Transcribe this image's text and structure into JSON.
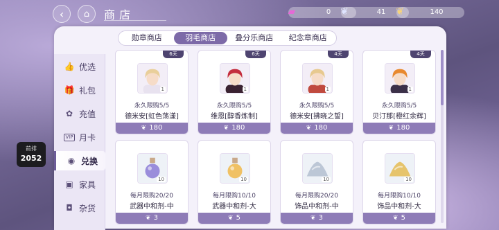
{
  "header": {
    "title": "商店"
  },
  "currencies": [
    {
      "icon": "ticket-icon",
      "value": "0"
    },
    {
      "icon": "feather-icon",
      "value": "41"
    },
    {
      "icon": "gold-feather-icon",
      "value": "140"
    }
  ],
  "sidebar": {
    "items": [
      {
        "label": "优选",
        "icon": "thumbs-up-icon"
      },
      {
        "label": "礼包",
        "icon": "gift-icon"
      },
      {
        "label": "充值",
        "icon": "flower-icon"
      },
      {
        "label": "月卡",
        "icon": "vip-card-icon"
      },
      {
        "label": "兑换",
        "icon": "exchange-icon",
        "active": true
      },
      {
        "label": "家具",
        "icon": "sofa-icon"
      },
      {
        "label": "杂货",
        "icon": "bag-icon"
      }
    ]
  },
  "rank": {
    "line1": "前排",
    "line2": "2052"
  },
  "tabs": [
    {
      "label": "勋章商店"
    },
    {
      "label": "羽毛商店",
      "active": true
    },
    {
      "label": "叠分乐商店"
    },
    {
      "label": "纪念章商店"
    }
  ],
  "items": [
    {
      "timer": "6天",
      "qty": "1",
      "limit": "永久限购5/5",
      "name": "德米安[虹色荡漾]",
      "price": "180",
      "kind": "portrait",
      "hair": "#e9cf9a",
      "cloth": "#e8e2ef"
    },
    {
      "timer": "6天",
      "qty": "1",
      "limit": "永久限购5/5",
      "name": "维恩[醇香炼制]",
      "price": "180",
      "kind": "portrait",
      "hair": "#c42d3d",
      "cloth": "#3a2231"
    },
    {
      "timer": "4天",
      "qty": "1",
      "limit": "永久限购5/5",
      "name": "德米安[拂晓之誓]",
      "price": "180",
      "kind": "portrait",
      "hair": "#e7c98f",
      "cloth": "#c04a3e"
    },
    {
      "timer": "4天",
      "qty": "1",
      "limit": "永久限购5/5",
      "name": "贝汀那[橙红余辉]",
      "price": "180",
      "kind": "portrait",
      "hair": "#e8892e",
      "cloth": "#3b3048"
    },
    {
      "timer": "",
      "qty": "10",
      "limit": "每月限购20/20",
      "name": "武器中和剂-中",
      "price": "3",
      "kind": "potion",
      "color": "#8b7bd6"
    },
    {
      "timer": "",
      "qty": "10",
      "limit": "每月限购10/10",
      "name": "武器中和剂-大",
      "price": "5",
      "kind": "potion",
      "color": "#f0b84a"
    },
    {
      "timer": "",
      "qty": "10",
      "limit": "每月限购20/20",
      "name": "饰品中和剂-中",
      "price": "3",
      "kind": "powder",
      "color": "#bcc7d6"
    },
    {
      "timer": "",
      "qty": "10",
      "limit": "每月限购10/10",
      "name": "饰品中和剂-大",
      "price": "5",
      "kind": "powder",
      "color": "#e6c46c"
    }
  ]
}
